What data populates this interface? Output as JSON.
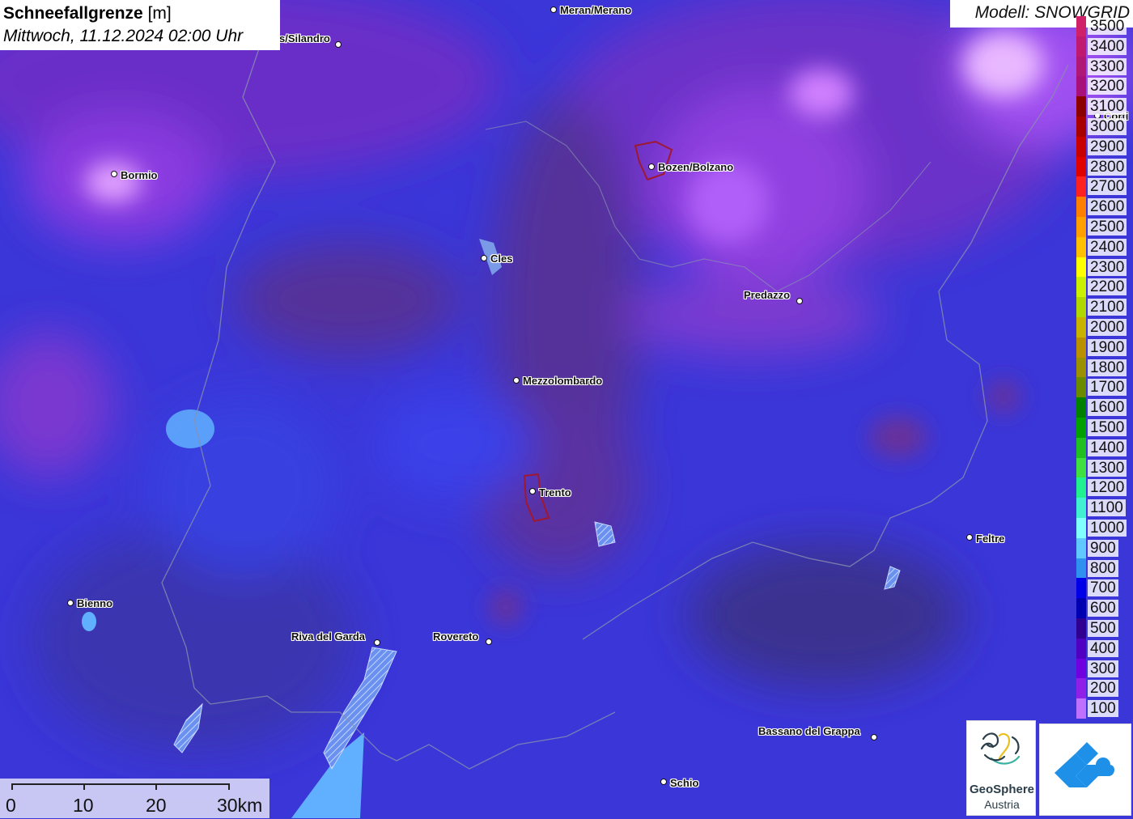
{
  "header": {
    "title_bold": "Schneefallgrenze",
    "title_unit": "[m]",
    "subtitle": "Mittwoch, 11.12.2024 02:00 Uhr"
  },
  "model": {
    "label": "Modell: SNOWGRID"
  },
  "cities": [
    {
      "name": "Meran/Merano",
      "key": "meran"
    },
    {
      "name": "s/Silandro",
      "key": "silandro"
    },
    {
      "name": "Bormio",
      "key": "bormio"
    },
    {
      "name": "Bozen/Bolzano",
      "key": "bozen"
    },
    {
      "name": "Cles",
      "key": "cles"
    },
    {
      "name": "Predazzo",
      "key": "predazzo"
    },
    {
      "name": "Mezzolombardo",
      "key": "mezzolombardo"
    },
    {
      "name": "Trento",
      "key": "trento"
    },
    {
      "name": "Feltre",
      "key": "feltre"
    },
    {
      "name": "Bienno",
      "key": "bienno"
    },
    {
      "name": "Riva del Garda",
      "key": "riva"
    },
    {
      "name": "Rovereto",
      "key": "rovereto"
    },
    {
      "name": "Bassano del Grappa",
      "key": "bassano"
    },
    {
      "name": "Schio",
      "key": "schio"
    },
    {
      "name": "Corti",
      "key": "corti"
    }
  ],
  "legend": {
    "unit": "m",
    "entries": [
      {
        "label": "3500",
        "color": "#d0206a"
      },
      {
        "label": "3400",
        "color": "#c01a70"
      },
      {
        "label": "3300",
        "color": "#b01878"
      },
      {
        "label": "3200",
        "color": "#a8107a"
      },
      {
        "label": "3100",
        "color": "#8b0000"
      },
      {
        "label": "3000",
        "color": "#a80000"
      },
      {
        "label": "2900",
        "color": "#c80000"
      },
      {
        "label": "2800",
        "color": "#e00000"
      },
      {
        "label": "2700",
        "color": "#ff2020"
      },
      {
        "label": "2600",
        "color": "#ff8000"
      },
      {
        "label": "2500",
        "color": "#ffa000"
      },
      {
        "label": "2400",
        "color": "#ffc000"
      },
      {
        "label": "2300",
        "color": "#ffff00"
      },
      {
        "label": "2200",
        "color": "#c8f000"
      },
      {
        "label": "2100",
        "color": "#b0d800"
      },
      {
        "label": "2000",
        "color": "#c8b400"
      },
      {
        "label": "1900",
        "color": "#b89000"
      },
      {
        "label": "1800",
        "color": "#9a9000"
      },
      {
        "label": "1700",
        "color": "#6a8a00"
      },
      {
        "label": "1600",
        "color": "#008000"
      },
      {
        "label": "1500",
        "color": "#00a000"
      },
      {
        "label": "1400",
        "color": "#20c020"
      },
      {
        "label": "1300",
        "color": "#40e040"
      },
      {
        "label": "1200",
        "color": "#20f090"
      },
      {
        "label": "1100",
        "color": "#40f0d0"
      },
      {
        "label": "1000",
        "color": "#80ffff"
      },
      {
        "label": "900",
        "color": "#60c8ff"
      },
      {
        "label": "800",
        "color": "#3090f0"
      },
      {
        "label": "700",
        "color": "#0000e8"
      },
      {
        "label": "600",
        "color": "#0000b0"
      },
      {
        "label": "500",
        "color": "#300090"
      },
      {
        "label": "400",
        "color": "#5000c0"
      },
      {
        "label": "300",
        "color": "#7000e0"
      },
      {
        "label": "200",
        "color": "#9020e8"
      },
      {
        "label": "100",
        "color": "#c070ff"
      }
    ]
  },
  "scalebar": {
    "labels": [
      "0",
      "10",
      "20",
      "30km"
    ]
  },
  "logos": {
    "geosphere_line1": "GeoSphere",
    "geosphere_line2": "Austria"
  }
}
